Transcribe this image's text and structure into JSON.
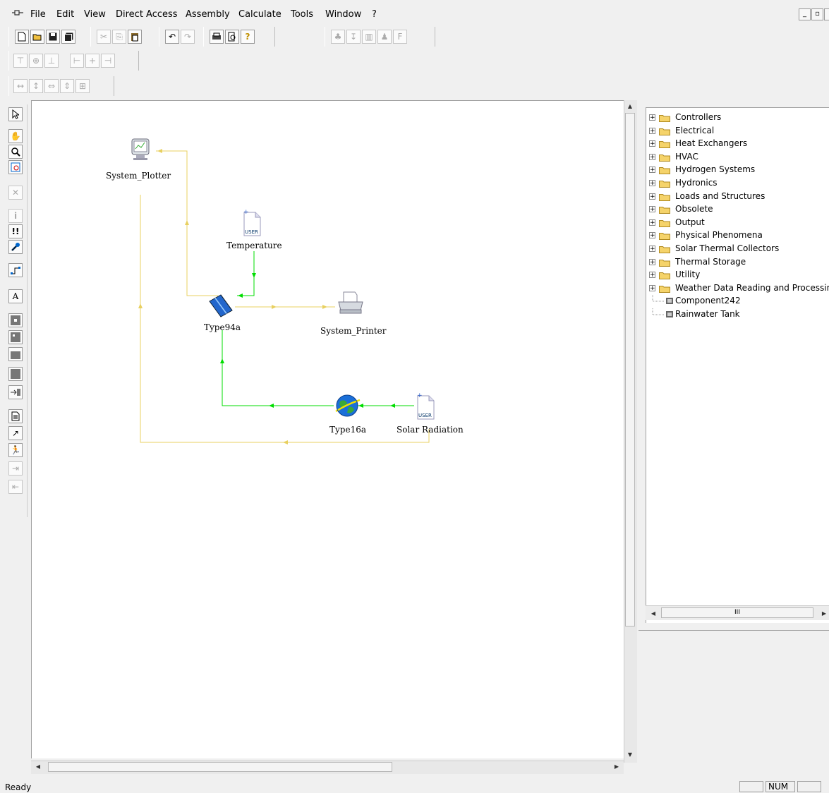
{
  "menubar": {
    "app_icon": "trnsys-studio-icon",
    "items": [
      "File",
      "Edit",
      "View",
      "Direct Access",
      "Assembly",
      "Calculate",
      "Tools",
      "Window",
      "?"
    ]
  },
  "canvas": {
    "components": {
      "plotter": {
        "label": "System_Plotter",
        "icon": "plotter-icon"
      },
      "temperature": {
        "label": "Temperature",
        "icon": "user-file-icon"
      },
      "collector": {
        "label": "Type94a",
        "icon": "pv-panel-icon"
      },
      "printer": {
        "label": "System_Printer",
        "icon": "printer-icon"
      },
      "radiation_processor": {
        "label": "Type16a",
        "icon": "globe-icon"
      },
      "solar_radiation": {
        "label": "Solar Radiation",
        "icon": "user-file-icon"
      }
    },
    "link_colors": {
      "data": "#00dd00",
      "output": "#e8d060"
    }
  },
  "tree": {
    "folders": [
      "Controllers",
      "Electrical",
      "Heat Exchangers",
      "HVAC",
      "Hydrogen Systems",
      "Hydronics",
      "Loads and Structures",
      "Obsolete",
      "Output",
      "Physical Phenomena",
      "Solar Thermal Collectors",
      "Thermal Storage",
      "Utility",
      "Weather Data Reading and Processin"
    ],
    "components": [
      "Component242",
      "Rainwater Tank"
    ],
    "scroll_thumb_label": "III"
  },
  "statusbar": {
    "text": "Ready",
    "cells": [
      "",
      "NUM",
      ""
    ]
  }
}
